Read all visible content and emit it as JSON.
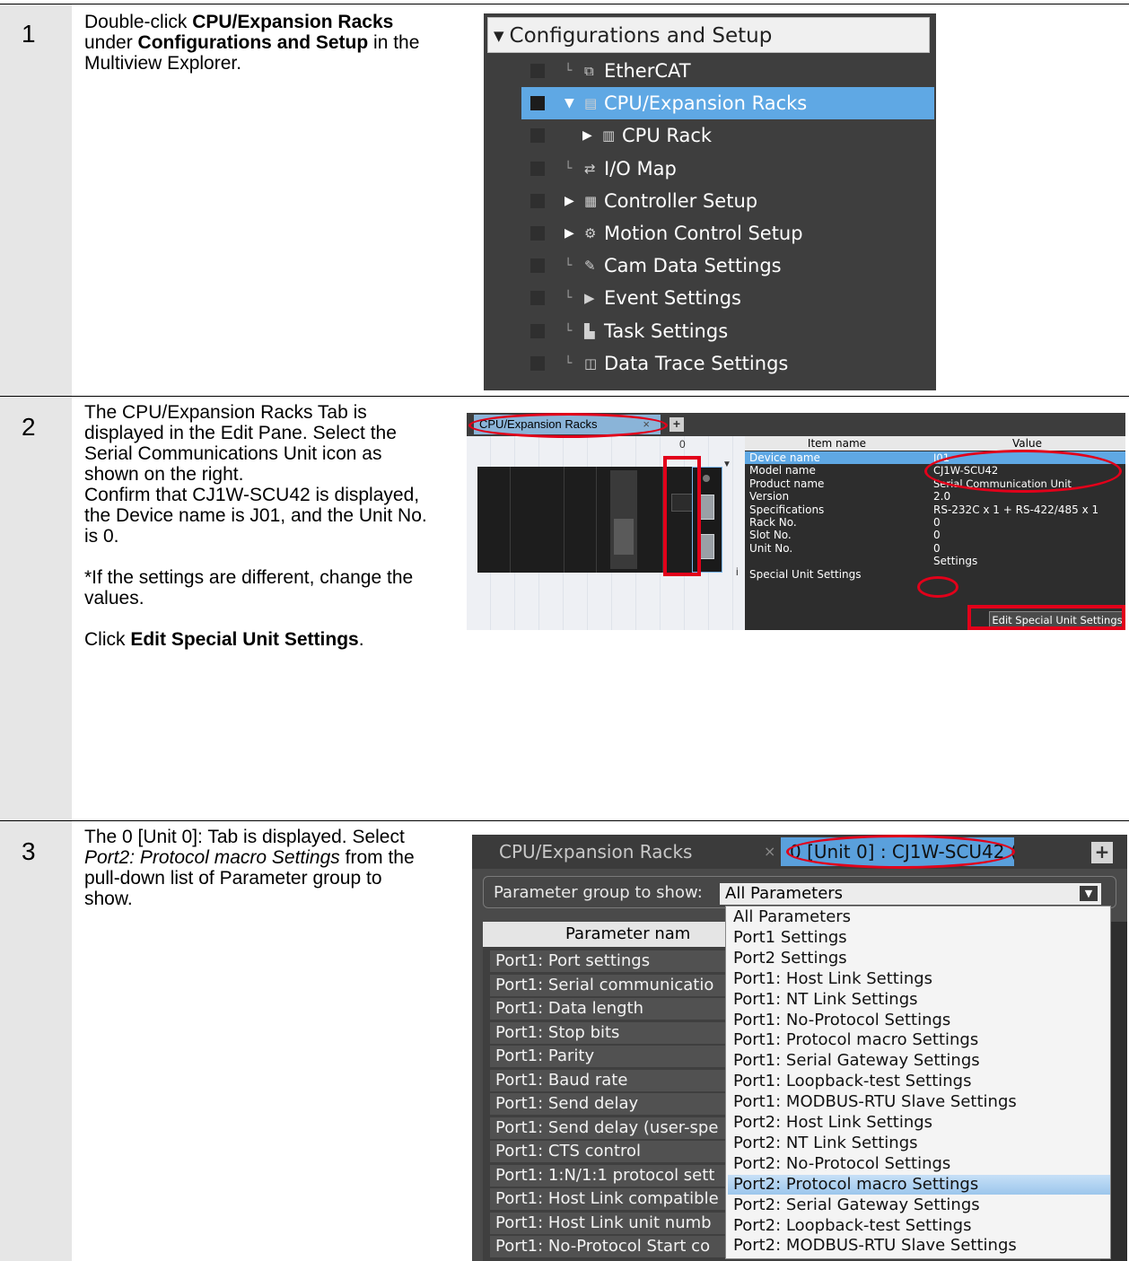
{
  "steps": [
    {
      "number": "1",
      "text": [
        [
          {
            "t": "Double-click "
          },
          {
            "t": "CPU/Expansion Racks",
            "b": true
          },
          {
            "t": " under "
          },
          {
            "t": "Configurations and Setup",
            "b": true
          },
          {
            "t": " in the Multiview Explorer."
          }
        ]
      ]
    },
    {
      "number": "2",
      "text": [
        [
          {
            "t": "The CPU/Expansion Racks Tab is displayed in the Edit Pane. Select the Serial Communications Unit icon as shown on the right."
          }
        ],
        [
          {
            "t": "Confirm that CJ1W-SCU42 is displayed, the Device name is J01, and the Unit No. is 0."
          }
        ],
        [],
        [
          {
            "t": "*If the settings are different, change the values."
          }
        ],
        [],
        [
          {
            "t": "Click "
          },
          {
            "t": "Edit Special Unit Settings",
            "b": true
          },
          {
            "t": "."
          }
        ]
      ]
    },
    {
      "number": "3",
      "text": [
        [
          {
            "t": "The 0 [Unit 0]: Tab is displayed. Select "
          },
          {
            "t": "Port2: Protocol macro Settings",
            "i": true
          },
          {
            "t": " from the pull-down list of Parameter group to show."
          }
        ]
      ]
    }
  ],
  "explorer": {
    "header": "Configurations and Setup",
    "items": [
      {
        "label": "EtherCAT",
        "icon": "ethercat-icon",
        "glyph": "⧉",
        "expand": "none"
      },
      {
        "label": "CPU/Expansion Racks",
        "icon": "rack-icon",
        "glyph": "▤",
        "expand": "open",
        "selected": true
      },
      {
        "label": "CPU Rack",
        "icon": "cpu-rack-icon",
        "glyph": "▥",
        "expand": "closed",
        "indent": true
      },
      {
        "label": "I/O Map",
        "icon": "io-map-icon",
        "glyph": "⇄",
        "expand": "none"
      },
      {
        "label": "Controller Setup",
        "icon": "controller-setup-icon",
        "glyph": "▦",
        "expand": "closed"
      },
      {
        "label": "Motion Control Setup",
        "icon": "motion-gear-icon",
        "glyph": "⚙",
        "expand": "closed"
      },
      {
        "label": "Cam Data Settings",
        "icon": "cam-data-icon",
        "glyph": "✎",
        "expand": "none"
      },
      {
        "label": "Event Settings",
        "icon": "event-flag-icon",
        "glyph": "▶",
        "expand": "none"
      },
      {
        "label": "Task Settings",
        "icon": "task-icon",
        "glyph": "▙",
        "expand": "none"
      },
      {
        "label": "Data Trace Settings",
        "icon": "data-trace-icon",
        "glyph": "◫",
        "expand": "none"
      }
    ]
  },
  "rack_view": {
    "tab_label": "CPU/Expansion Racks",
    "tab_close": "×",
    "add_tab": "+",
    "slot_label": "0",
    "unit_badge": "i",
    "columns": {
      "item": "Item name",
      "value": "Value"
    },
    "rows": [
      {
        "item": "Device name",
        "value": "J01",
        "selected": true
      },
      {
        "item": "Model name",
        "value": "CJ1W-SCU42"
      },
      {
        "item": "Product name",
        "value": "Serial Communication Unit"
      },
      {
        "item": "Version",
        "value": "2.0"
      },
      {
        "item": "Specifications",
        "value": "RS-232C x 1 + RS-422/485 x 1"
      },
      {
        "item": "Rack No.",
        "value": "0"
      },
      {
        "item": "Slot No.",
        "value": "0"
      },
      {
        "item": "Unit No.",
        "value": "0"
      },
      {
        "item": "",
        "value": "Settings"
      },
      {
        "item": "Special Unit Settings",
        "value": ""
      }
    ],
    "edit_button": "Edit Special Unit Settings"
  },
  "unit_settings": {
    "tab_inactive": "CPU/Expansion Racks",
    "tab_active": "0 [Unit 0] : CJ1W-SCU42 (...",
    "tab_close": "×",
    "add_tab": "+",
    "group_label": "Parameter group to show:",
    "group_value": "All Parameters",
    "param_header": "Parameter nam",
    "params": [
      "Port1: Port settings",
      "Port1: Serial communicatio",
      "Port1: Data length",
      "Port1: Stop bits",
      "Port1: Parity",
      "Port1: Baud rate",
      "Port1: Send delay",
      "Port1: Send delay (user-spe",
      "Port1: CTS control",
      "Port1: 1:N/1:1 protocol sett",
      "Port1: Host Link compatible",
      "Port1: Host Link unit numb",
      "Port1: No-Protocol Start co"
    ],
    "options": [
      "All Parameters",
      "Port1 Settings",
      "Port2 Settings",
      "Port1: Host Link Settings",
      "Port1: NT Link Settings",
      "Port1: No-Protocol Settings",
      "Port1: Protocol macro Settings",
      "Port1: Serial Gateway Settings",
      "Port1: Loopback-test Settings",
      "Port1: MODBUS-RTU Slave Settings",
      "Port2: Host Link Settings",
      "Port2: NT Link Settings",
      "Port2: No-Protocol Settings",
      "Port2: Protocol macro Settings",
      "Port2: Serial Gateway Settings",
      "Port2: Loopback-test Settings",
      "Port2: MODBUS-RTU Slave Settings"
    ],
    "highlighted_option": "Port2: Protocol macro Settings"
  }
}
